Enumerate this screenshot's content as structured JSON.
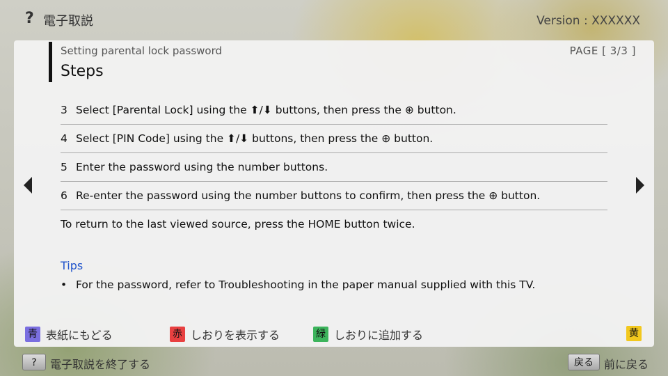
{
  "header": {
    "help_glyph": "?",
    "app_title": "電子取説",
    "version": "Version : XXXXXX"
  },
  "panel": {
    "subtitle": "Setting parental lock password",
    "page_indicator": "PAGE [ 3/3 ]",
    "title": "Steps",
    "steps": [
      {
        "num": "3",
        "text": "Select [Parental Lock] using the ⬆/⬇ buttons, then press the ⊕ button."
      },
      {
        "num": "4",
        "text": "Select [PIN Code] using the ⬆/⬇ buttons, then press the ⊕ button."
      },
      {
        "num": "5",
        "text": "Enter the password using the number buttons."
      },
      {
        "num": "6",
        "text": "Re-enter the password using the number buttons to confirm, then press the ⊕ button."
      }
    ],
    "note": "To return to the last viewed source, press the HOME button twice.",
    "tips_heading": "Tips",
    "tips": [
      {
        "bullet": "•",
        "text": "For the password, refer to Troubleshooting in the paper manual supplied with this TV."
      }
    ]
  },
  "color_keys": {
    "blue": {
      "key": "青",
      "label": "表紙にもどる",
      "color": "#7a6fe0"
    },
    "red": {
      "key": "赤",
      "label": "しおりを表示する",
      "color": "#e84040"
    },
    "green": {
      "key": "緑",
      "label": "しおりに追加する",
      "color": "#3cb45c"
    },
    "yellow": {
      "key": "黄",
      "color": "#f2c81e"
    }
  },
  "footer": {
    "help_button": "?",
    "exit_label": "電子取説を終了する",
    "back_button": "戻る",
    "back_label": "前に戻る"
  },
  "icons": {
    "nav_left": "triangle-left-icon",
    "nav_right": "triangle-right-icon"
  }
}
